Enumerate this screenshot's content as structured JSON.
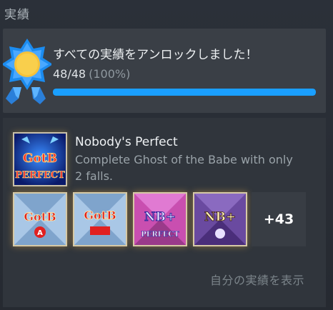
{
  "section": {
    "title": "実績"
  },
  "summary": {
    "title": "すべての実績をアンロックしました！",
    "count": "48/48",
    "percent_label": "(100%)",
    "progress": 1.0,
    "badge_icon": "sun-badge-icon",
    "accent_color": "#1a9fff"
  },
  "featured": {
    "name": "Nobody's Perfect",
    "description": "Complete Ghost of the Babe with only 2 falls.",
    "icon": "gotb-perfect-icon"
  },
  "icons": [
    {
      "name": "gotb-a-icon",
      "text": "GotB"
    },
    {
      "name": "gotb-b-icon",
      "text": "GotB"
    },
    {
      "name": "nb-perfect-icon",
      "text": "NB+"
    },
    {
      "name": "nb-plus-icon",
      "text": "NB+"
    }
  ],
  "more_count": "+43",
  "view_link": "自分の実績を表示"
}
